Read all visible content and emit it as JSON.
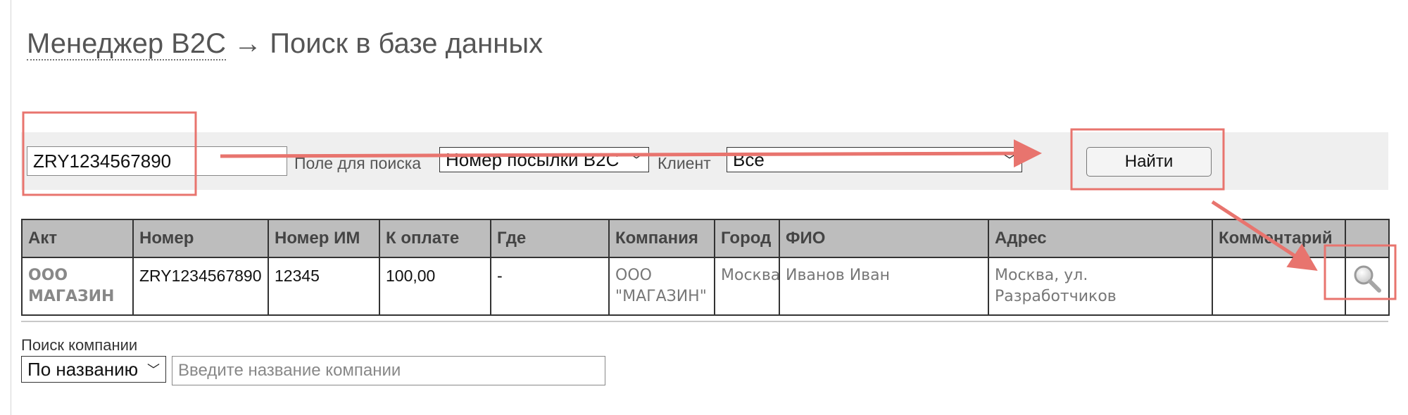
{
  "breadcrumb": {
    "parent": "Менеджер B2C",
    "separator": " → ",
    "current": "Поиск в базе данных"
  },
  "search": {
    "query_value": "ZRY1234567890",
    "field_label": "Поле для поиска",
    "field_select": "Номер посылки B2C",
    "client_label": "Клиент",
    "client_select": "Все",
    "find_label": "Найти"
  },
  "table": {
    "headers": [
      "Акт",
      "Номер",
      "Номер ИМ",
      "К оплате",
      "Где",
      "Компания",
      "Город",
      "ФИО",
      "Адрес",
      "Комментарий",
      ""
    ],
    "rows": [
      {
        "act": "ООО МАГАЗИН",
        "number": "ZRY1234567890",
        "shop_number": "12345",
        "to_pay": "100,00",
        "where": "-",
        "company": "ООО \"МАГАЗИН\"",
        "city": "Москва",
        "name": "Иванов Иван",
        "address": "Москва, ул. Разработчиков",
        "comment": "",
        "action_icon": "magnifier-icon"
      }
    ]
  },
  "company_search": {
    "label": "Поиск компании",
    "mode_select": "По названию",
    "placeholder": "Введите название компании"
  },
  "colors": {
    "annotation": "#e8746e",
    "header_bg": "#bdbdbd",
    "bar_bg": "#efefef"
  }
}
